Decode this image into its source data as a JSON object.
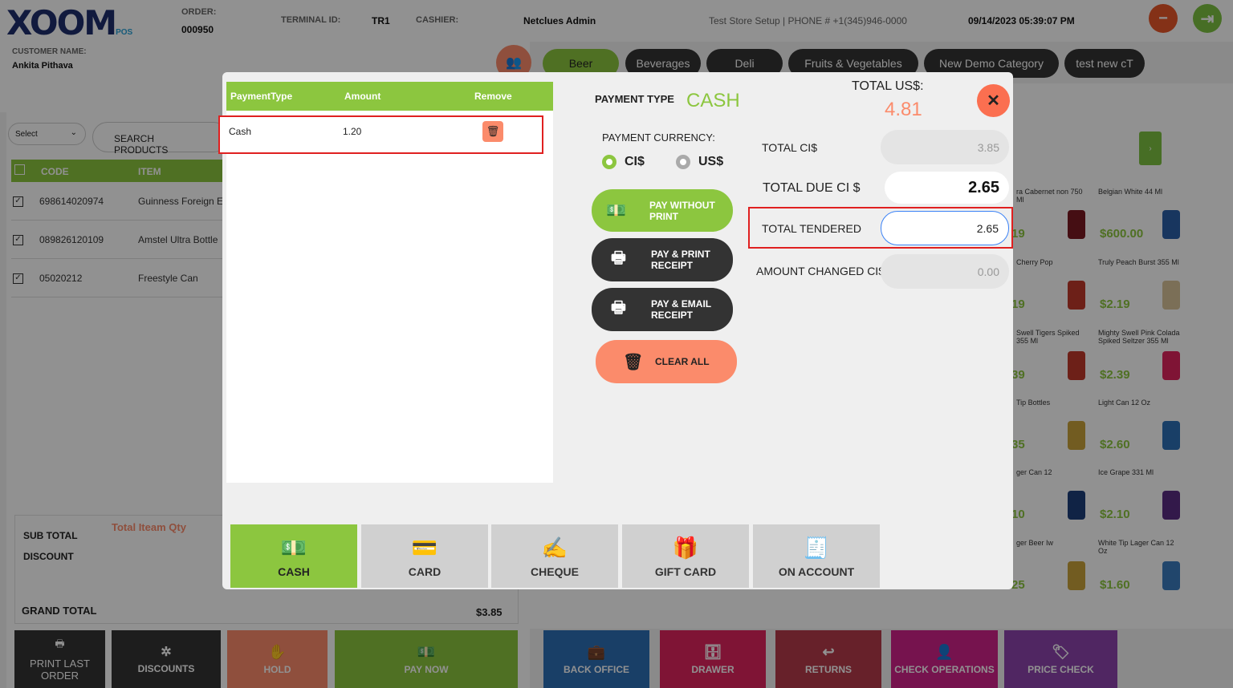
{
  "app": {
    "logo": "XOOM",
    "logo_sub": "POS"
  },
  "header": {
    "order_label": "ORDER:",
    "order_value": "000950",
    "terminal_label": "TERMINAL ID:",
    "terminal_value": "TR1",
    "cashier_label": "CASHIER:",
    "cashier_value": "Netclues Admin",
    "store": "Test Store Setup | PHONE # +1(345)946-0000",
    "datetime": "09/14/2023 05:39:07 PM"
  },
  "customer": {
    "label": "CUSTOMER NAME:",
    "name": "Ankita Pithava"
  },
  "search": {
    "select_label": "Select",
    "placeholder": "SEARCH PRODUCTS"
  },
  "grid": {
    "col_code": "CODE",
    "col_item": "ITEM",
    "rows": [
      {
        "code": "698614020974",
        "item": "Guinness Foreign E"
      },
      {
        "code": "089826120109",
        "item": "Amstel Ultra Bottle"
      },
      {
        "code": "05020212",
        "item": "Freestyle Can"
      }
    ]
  },
  "totals": {
    "sub_total": "SUB TOTAL",
    "total_qty": "Total Iteam Qty",
    "discount": "DISCOUNT",
    "grand_total": "GRAND TOTAL",
    "grand_total_value": "$3.85"
  },
  "bottom_left": {
    "print_last": "PRINT LAST ORDER",
    "discounts": "DISCOUNTS",
    "hold": "HOLD",
    "pay_now": "PAY NOW"
  },
  "bottom_right": {
    "back_office": "BACK OFFICE",
    "drawer": "DRAWER",
    "returns": "RETURNS",
    "check_ops": "CHECK OPERATIONS",
    "price_check": "PRICE CHECK"
  },
  "categories": [
    "Beer",
    "Beverages",
    "Deli",
    "Fruits & Vegetables",
    "New Demo Category",
    "test new cT"
  ],
  "products": [
    {
      "name": "ra Cabernet non 750 Ml",
      "price": "19"
    },
    {
      "name": "Belgian White 44 Ml",
      "price": "$600.00"
    },
    {
      "name": "Cherry Pop",
      "price": "19"
    },
    {
      "name": "Truly Peach Burst 355 Ml",
      "price": "$2.19"
    },
    {
      "name": "Swell Tigers Spiked 355 Ml",
      "price": "39"
    },
    {
      "name": "Mighty Swell Pink Colada Spiked Seltzer 355 Ml",
      "price": "$2.39"
    },
    {
      "name": "Tip Bottles",
      "price": "35"
    },
    {
      "name": "Light Can 12 Oz",
      "price": "$2.60"
    },
    {
      "name": "ger Can 12",
      "price": "10"
    },
    {
      "name": "Ice Grape 331 Ml",
      "price": "$2.10"
    },
    {
      "name": "ger Beer Iw",
      "price": "25"
    },
    {
      "name": "White Tip Lager Can 12 Oz",
      "price": "$1.60"
    }
  ],
  "modal": {
    "table": {
      "col_type": "PaymentType",
      "col_amount": "Amount",
      "col_remove": "Remove",
      "rows": [
        {
          "type": "Cash",
          "amount": "1.20"
        }
      ]
    },
    "payment_type_label": "PAYMENT TYPE",
    "payment_type_value": "CASH",
    "total_us_label": "TOTAL US$:",
    "total_us_value": "4.81",
    "currency_label": "PAYMENT CURRENCY:",
    "currency_ci": "CI$",
    "currency_us": "US$",
    "pay_without_print": "PAY WITHOUT PRINT",
    "pay_print": "PAY & PRINT RECEIPT",
    "pay_email": "PAY & EMAIL RECEIPT",
    "clear_all": "CLEAR ALL",
    "total_ci_label": "TOTAL CI$",
    "total_ci_value": "3.85",
    "total_due_label": "TOTAL DUE CI $",
    "total_due_value": "2.65",
    "tendered_label": "TOTAL TENDERED",
    "tendered_value": "2.65",
    "changed_label": "AMOUNT CHANGED CI$",
    "changed_value": "0.00",
    "types": {
      "cash": "CASH",
      "card": "CARD",
      "cheque": "CHEQUE",
      "gift": "GIFT CARD",
      "account": "ON ACCOUNT"
    }
  },
  "colors": {
    "green": "#8cc63f",
    "orange": "#fb8b6b",
    "dark": "#333333",
    "accent_red": "#e02020"
  }
}
